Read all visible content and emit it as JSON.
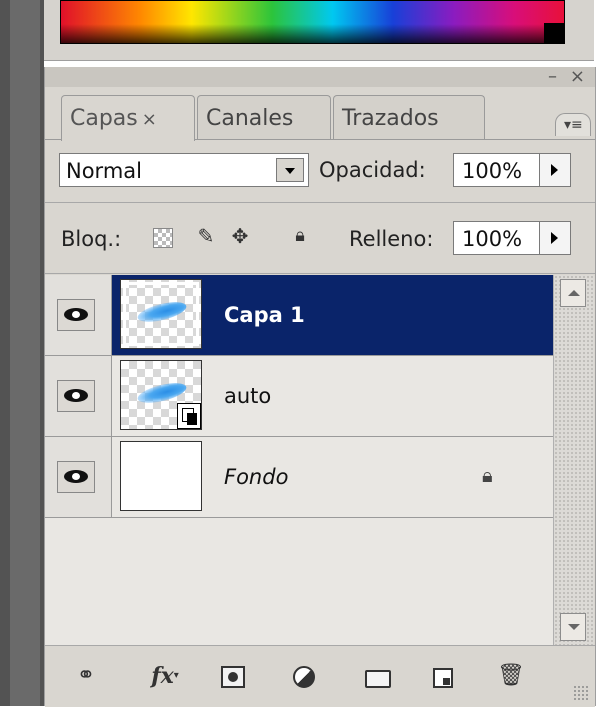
{
  "tabs": [
    {
      "label": "Capas",
      "close": "×",
      "active": true
    },
    {
      "label": "Canales",
      "active": false
    },
    {
      "label": "Trazados",
      "active": false
    }
  ],
  "window_controls": {
    "minimize": "–",
    "close": "×"
  },
  "panel_menu_glyph": "▾≡",
  "blend": {
    "mode": "Normal",
    "opacity_label": "Opacidad:",
    "opacity_value": "100%"
  },
  "lock": {
    "label": "Bloq.:",
    "fill_label": "Relleno:",
    "fill_value": "100%",
    "icons": [
      "transparency-lock-icon",
      "brush-lock-icon",
      "move-lock-icon",
      "padlock-icon"
    ]
  },
  "layers": [
    {
      "name": "Capa 1",
      "selected": true,
      "visible": true,
      "thumb": "checker-brush"
    },
    {
      "name": "auto",
      "selected": false,
      "visible": true,
      "thumb": "smart-object"
    },
    {
      "name": "Fondo",
      "selected": false,
      "visible": true,
      "thumb": "white",
      "locked": true
    }
  ],
  "bottom_icons": [
    "link-icon",
    "fx-icon",
    "mask-icon",
    "adjustment-icon",
    "folder-icon",
    "new-layer-icon",
    "trash-icon"
  ],
  "colors": {
    "selection": "#0a246a",
    "panel_bg": "#d9d6d0",
    "list_bg": "#e9e7e3"
  }
}
